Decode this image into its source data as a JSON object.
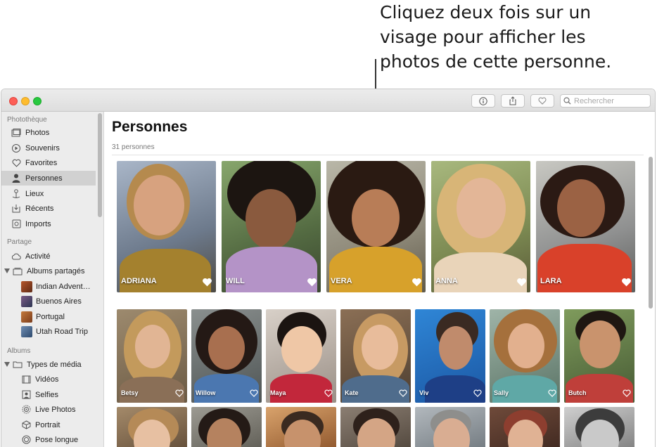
{
  "callout": {
    "lines": [
      "Cliquez deux fois sur un",
      "visage pour afficher les",
      "photos de cette personne."
    ]
  },
  "toolbar": {
    "info_icon": "info-icon",
    "share_icon": "share-icon",
    "favorite_icon": "heart-icon",
    "search_placeholder": "Rechercher"
  },
  "sidebar": {
    "sections": {
      "library": "Photothèque",
      "sharing": "Partage",
      "albums": "Albums"
    },
    "library_items": [
      {
        "label": "Photos",
        "icon": "photos-icon"
      },
      {
        "label": "Souvenirs",
        "icon": "memories-icon"
      },
      {
        "label": "Favorites",
        "icon": "heart-icon"
      },
      {
        "label": "Personnes",
        "icon": "person-icon",
        "selected": true
      },
      {
        "label": "Lieux",
        "icon": "pin-icon"
      },
      {
        "label": "Récents",
        "icon": "recent-icon"
      },
      {
        "label": "Imports",
        "icon": "import-icon"
      }
    ],
    "sharing_items": [
      {
        "label": "Activité",
        "icon": "cloud-icon"
      },
      {
        "label": "Albums partagés",
        "icon": "shared-albums-icon"
      },
      {
        "label": "Indian Advent…"
      },
      {
        "label": "Buenos Aires"
      },
      {
        "label": "Portugal"
      },
      {
        "label": "Utah Road Trip"
      }
    ],
    "album_items": [
      {
        "label": "Types de média",
        "icon": "folder-icon"
      },
      {
        "label": "Vidéos",
        "icon": "video-icon"
      },
      {
        "label": "Selfies",
        "icon": "selfie-icon"
      },
      {
        "label": "Live Photos",
        "icon": "live-photo-icon"
      },
      {
        "label": "Portrait",
        "icon": "portrait-icon"
      },
      {
        "label": "Pose longue",
        "icon": "long-exposure-icon"
      }
    ]
  },
  "main": {
    "title": "Personnes",
    "count": "31 personnes",
    "favorites": [
      {
        "name": "ADRIANA"
      },
      {
        "name": "WILL"
      },
      {
        "name": "VERA"
      },
      {
        "name": "ANNA"
      },
      {
        "name": "LARA"
      }
    ],
    "people": [
      {
        "name": "Betsy"
      },
      {
        "name": "Willow"
      },
      {
        "name": "Maya"
      },
      {
        "name": "Kate"
      },
      {
        "name": "Viv"
      },
      {
        "name": "Sally"
      },
      {
        "name": "Butch"
      }
    ]
  },
  "colors": {
    "sidebar_bg": "#ececec",
    "selected_row": "#d1d1d1",
    "accent_close": "#fd5f57",
    "accent_minimize": "#febc2e",
    "accent_zoom": "#28c840"
  }
}
